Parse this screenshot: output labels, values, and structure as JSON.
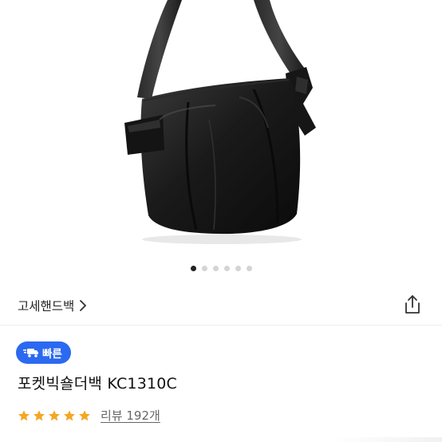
{
  "gallery": {
    "image_alt": "black leather shoulder bag",
    "page_count": 6,
    "active_index": 0
  },
  "brand": {
    "name": "고세핸드백",
    "chevron_icon": "chevron-right-icon"
  },
  "share": {
    "icon": "share-icon"
  },
  "badge": {
    "label": "빠른",
    "icon": "fast-truck-icon",
    "color": "#2b69f0"
  },
  "product": {
    "title": "포켓빅숄더백 KC1310C"
  },
  "rating": {
    "stars": 5,
    "star_color": "#f5a623",
    "review_label": "리뷰 192개"
  }
}
